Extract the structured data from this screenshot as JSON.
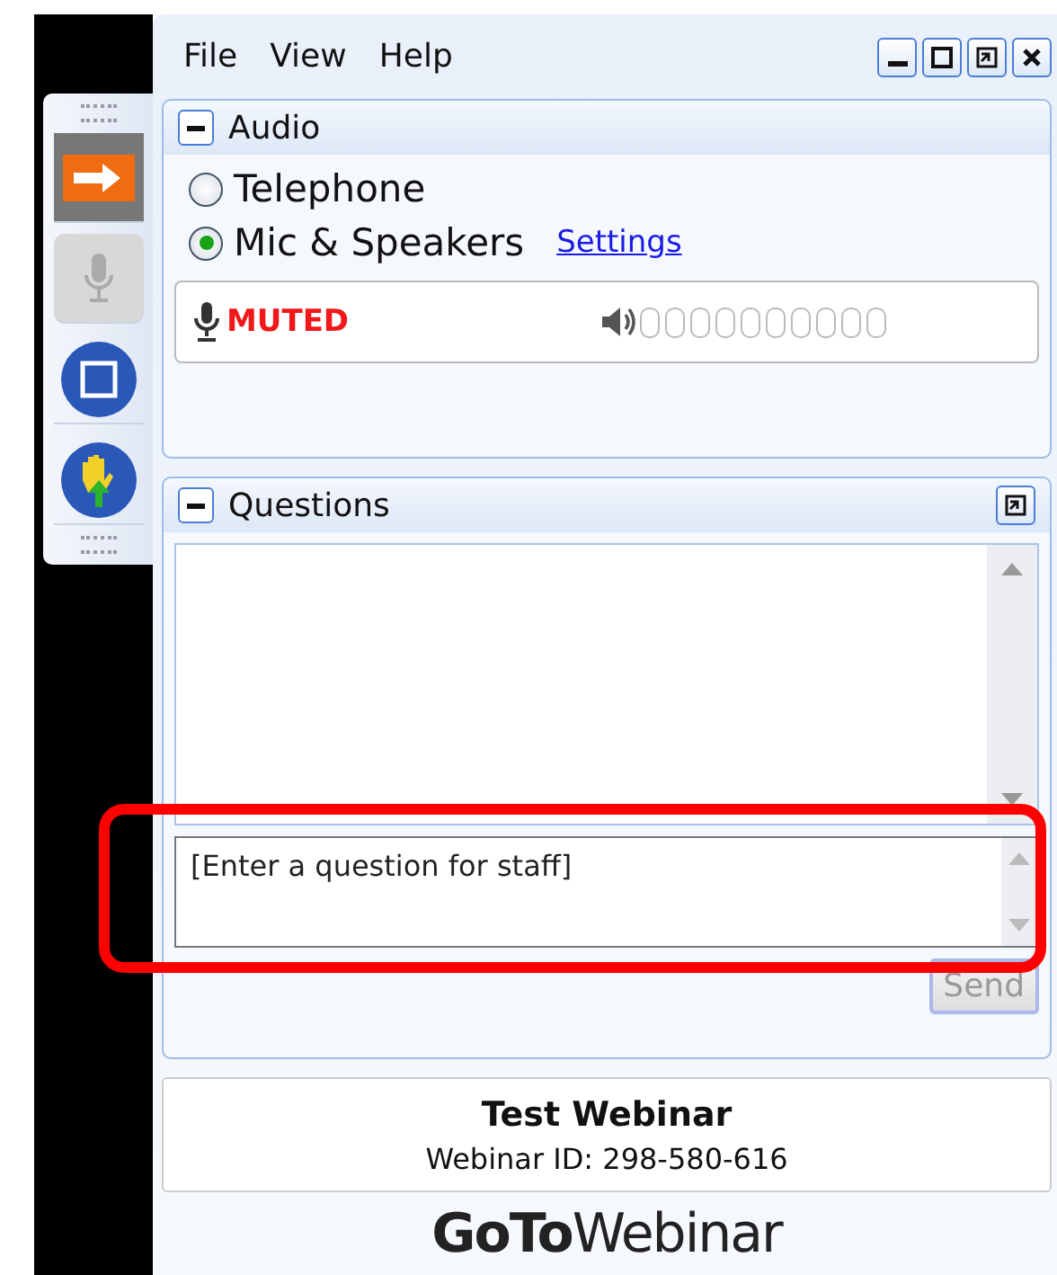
{
  "side_panel": {
    "buttons": [
      {
        "kind": "arrow",
        "disabled": false
      },
      {
        "kind": "mic",
        "disabled": true
      },
      {
        "kind": "screen",
        "disabled": false
      },
      {
        "kind": "hand",
        "disabled": false
      }
    ]
  },
  "menu": [
    "File",
    "View",
    "Help"
  ],
  "audio": {
    "title": "Audio",
    "expanded": true,
    "options": [
      {
        "label": "Telephone",
        "selected": false
      },
      {
        "label": "Mic & Speakers",
        "selected": true
      }
    ],
    "settings_link": "Settings",
    "mic_status": "MUTED"
  },
  "questions": {
    "title": "Questions",
    "expanded": true,
    "input": {
      "placeholder": "[Enter a question for staff]",
      "highlighted": true
    },
    "send": {
      "label": "Send",
      "disabled": true
    }
  },
  "webinar": {
    "title": "Test Webinar",
    "id_line": "Webinar ID: 298-580-616"
  },
  "logo": "**GoTo**Webinar"
}
